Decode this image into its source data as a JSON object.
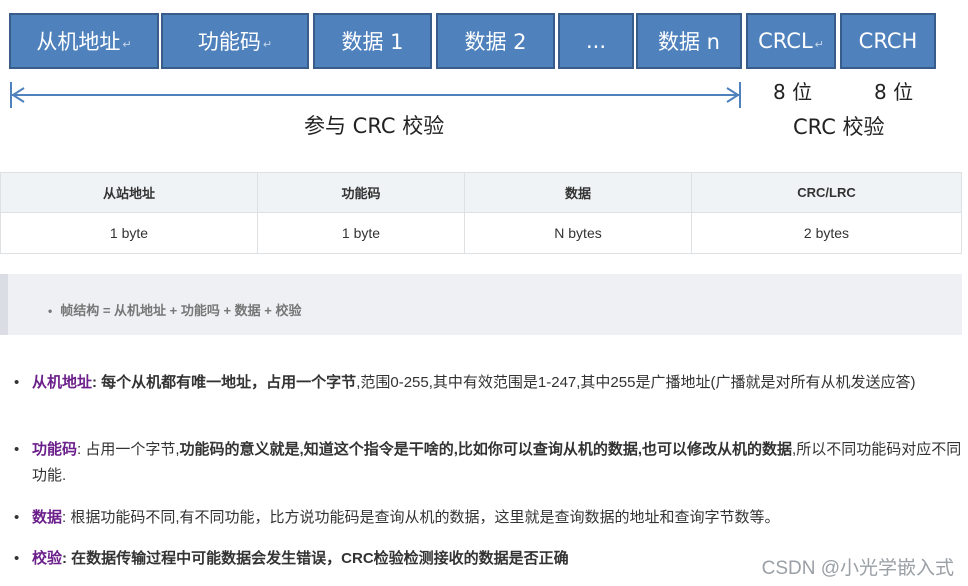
{
  "diagram": {
    "cells": [
      "从机地址",
      "功能码",
      "数据 1",
      "数据 2",
      "...",
      "数据 n",
      "CRCL",
      "CRCH"
    ],
    "bits_l": "8 位",
    "bits_h": "8 位",
    "range_caption": "参与 CRC 校验",
    "crc_caption": "CRC 校验"
  },
  "table": {
    "headers": [
      "从站地址",
      "功能码",
      "数据",
      "CRC/LRC"
    ],
    "row": [
      "1 byte",
      "1 byte",
      "N bytes",
      "2 bytes"
    ]
  },
  "quote": {
    "item": "帧结构 = 从机地址 + 功能吗 + 数据 + 校验"
  },
  "defs": [
    {
      "term": "从机地址",
      "bold": ": 每个从机都有唯一地址，占用一个字节",
      "rest": ",范围0-255,其中有效范围是1-247,其中255是广播地址(广播就是对所有从机发送应答)"
    },
    {
      "term": "功能码",
      "pre": ": 占用一个字节,",
      "bold": "功能码的意义就是,知道这个指令是干啥的,比如你可以查询从机的数据,也可以修改从机的数据",
      "rest": ",所以不同功能码对应不同功能."
    },
    {
      "term": "数据",
      "rest": ": 根据功能码不同,有不同功能，比方说功能码是查询从机的数据，这里就是查询数据的地址和查询字节数等。"
    },
    {
      "term": "校验",
      "bold": ": 在数据传输过程中可能数据会发生错误，CRC检验检测接收的数据是否正确"
    }
  ],
  "watermark": "CSDN @小光学嵌入式"
}
